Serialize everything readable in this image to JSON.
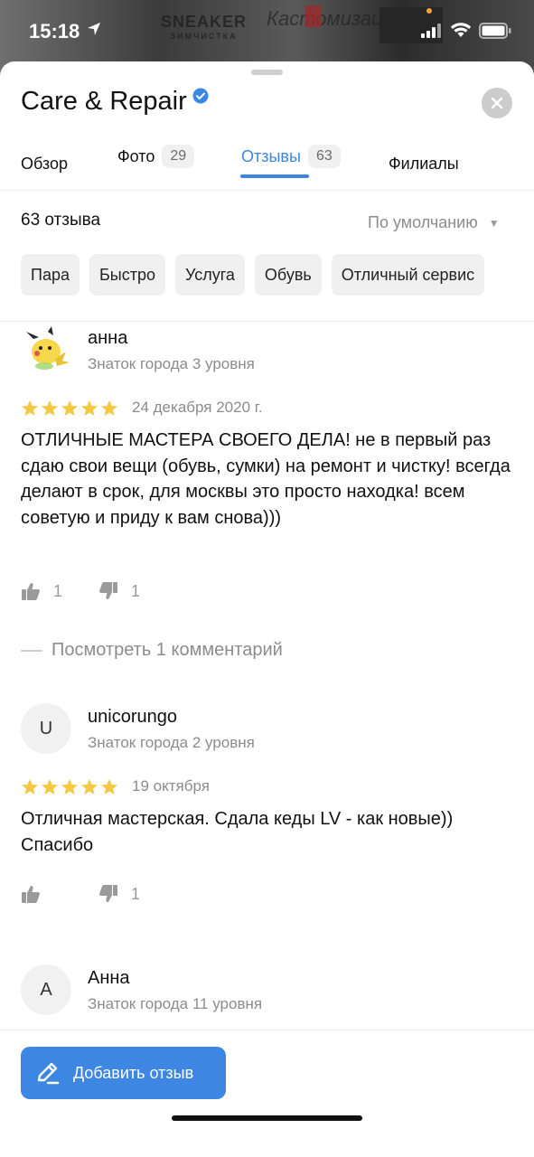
{
  "status_bar": {
    "time": "15:18"
  },
  "background": {
    "sign1": "SNEAKER",
    "sign1_sub": "ЗИМЧИСТКА",
    "sign2": "Кастомизация"
  },
  "header": {
    "title": "Care & Repair",
    "verified_icon": "verified-badge-icon",
    "close_icon": "close-icon"
  },
  "tabs": [
    {
      "label": "Обзор",
      "count": null,
      "active": false
    },
    {
      "label": "Фото",
      "count": "29",
      "active": false
    },
    {
      "label": "Отзывы",
      "count": "63",
      "active": true
    },
    {
      "label": "Филиалы",
      "count": null,
      "active": false
    }
  ],
  "reviews_summary": {
    "count_label": "63 отзыва",
    "sort_label": "По умолчанию"
  },
  "chips": [
    "Пара",
    "Быстро",
    "Услуга",
    "Обувь",
    "Отличный сервис"
  ],
  "reviews": [
    {
      "name": "анна",
      "avatar_letter": "",
      "level": "Знаток города 3 уровня",
      "stars": 5,
      "date": "24 декабря 2020 г.",
      "text": "ОТЛИЧНЫЕ МАСТЕРА СВОЕГО ДЕЛА! не в первый раз сдаю свои вещи (обувь, сумки) на ремонт и чистку! всегда делают в срок, для москвы это просто находка! всем советую и приду к вам снова)))",
      "likes": "1",
      "dislikes": "1"
    },
    {
      "name": "unicorungo",
      "avatar_letter": "U",
      "level": "Знаток города 2 уровня",
      "stars": 5,
      "date": "19 октября",
      "text": "Отличная мастерская. Сдала кеды LV - как новые)) Спасибо",
      "likes": "",
      "dislikes": "1"
    },
    {
      "name": "Анна",
      "avatar_letter": "А",
      "level": "Знаток города 11 уровня"
    }
  ],
  "comments_link": "Посмотреть 1 комментарий",
  "bottom": {
    "add_review_label": "Добавить отзыв"
  },
  "colors": {
    "accent": "#3d87e3",
    "star": "#f5c842",
    "muted": "#8c8c8c"
  }
}
